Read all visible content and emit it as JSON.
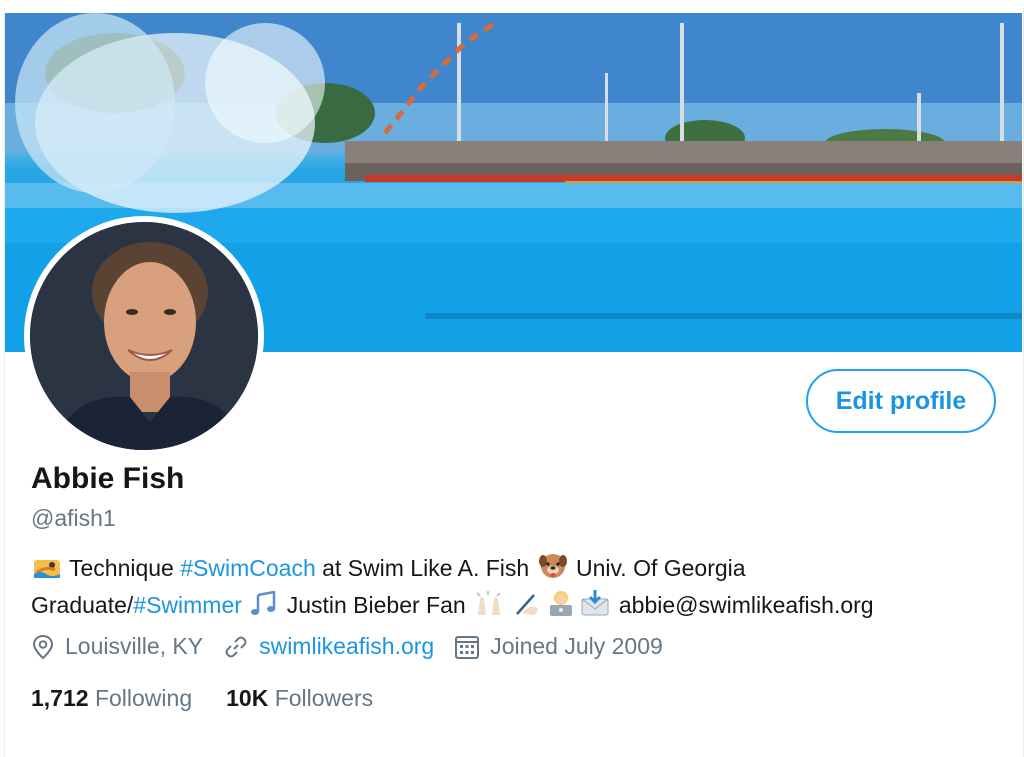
{
  "profile": {
    "name": "Abbie Fish",
    "handle": "@afish1",
    "edit_label": "Edit profile"
  },
  "bio": {
    "line1": {
      "pre": "Technique ",
      "hashtag1": "#SwimCoach",
      "mid": " at Swim Like A. Fish ",
      "post": " Univ. Of Georgia"
    },
    "line2": {
      "pre": "Graduate/",
      "hashtag2": "#Swimmer",
      "mid": " Justin Bieber Fan ",
      "email": "abbie@swimlikeafish.org"
    }
  },
  "meta": {
    "location": "Louisville, KY",
    "website": "swimlikeafish.org",
    "joined": "Joined July 2009"
  },
  "stats": {
    "following_count": "1,712",
    "following_label": "Following",
    "followers_count": "10K",
    "followers_label": "Followers"
  },
  "icons": {
    "location": "location-pin-icon",
    "link": "link-icon",
    "calendar": "calendar-icon"
  },
  "colors": {
    "accent": "#1da1f2",
    "link": "#1b95e0",
    "muted": "#657786",
    "text": "#14171a"
  }
}
